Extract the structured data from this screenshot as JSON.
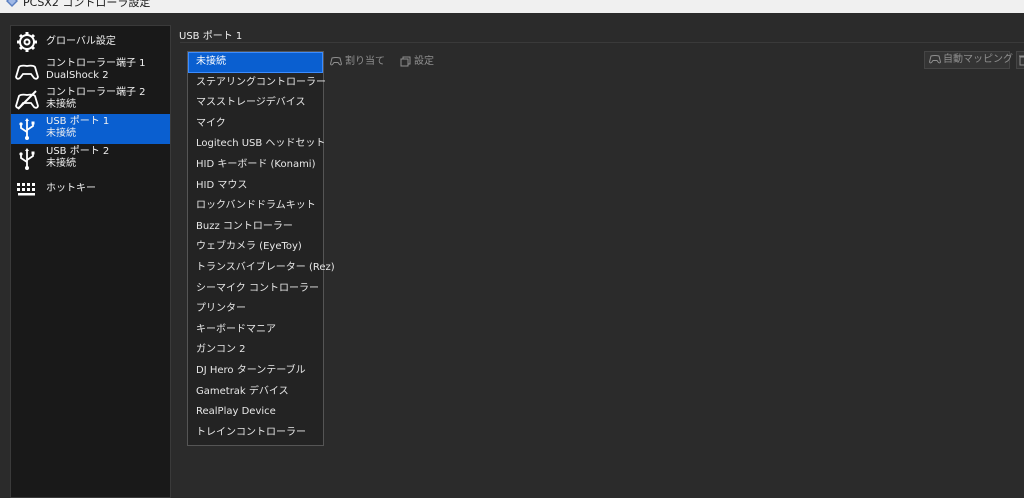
{
  "window": {
    "title": "PCSX2 コントローラ設定"
  },
  "sidebar": {
    "items": [
      {
        "label": "グローバル設定",
        "icon": "gear-icon"
      },
      {
        "label": "コントローラー端子 1",
        "sub": "DualShock 2",
        "icon": "gamepad-icon"
      },
      {
        "label": "コントローラー端子 2",
        "sub": "未接続",
        "icon": "gamepad-disconnected-icon"
      },
      {
        "label": "USB ポート 1",
        "sub": "未接続",
        "icon": "usb-icon",
        "selected": true
      },
      {
        "label": "USB ポート 2",
        "sub": "未接続",
        "icon": "usb-icon"
      },
      {
        "label": "ホットキー",
        "icon": "keyboard-icon"
      }
    ]
  },
  "main": {
    "title": "USB ポート 1",
    "toolbar": {
      "bind_label": "割り当て",
      "settings_label": "設定",
      "auto_mapping_label": "自動マッピング"
    }
  },
  "device_dropdown": {
    "selected": "未接続",
    "options": [
      "未接続",
      "ステアリングコントローラー",
      "マスストレージデバイス",
      "マイク",
      "Logitech USB ヘッドセット",
      "HID キーボード (Konami)",
      "HID マウス",
      "ロックバンドドラムキット",
      "Buzz コントローラー",
      "ウェブカメラ (EyeToy)",
      "トランスバイブレーター (Rez)",
      "シーマイク コントローラー",
      "プリンター",
      "キーボードマニア",
      "ガンコン 2",
      "DJ Hero ターンテーブル",
      "Gametrak デバイス",
      "RealPlay Device",
      "トレインコントローラー"
    ]
  },
  "colors": {
    "accent": "#0a5fd0",
    "background": "#2b2b2b",
    "sidebar": "#191919"
  }
}
